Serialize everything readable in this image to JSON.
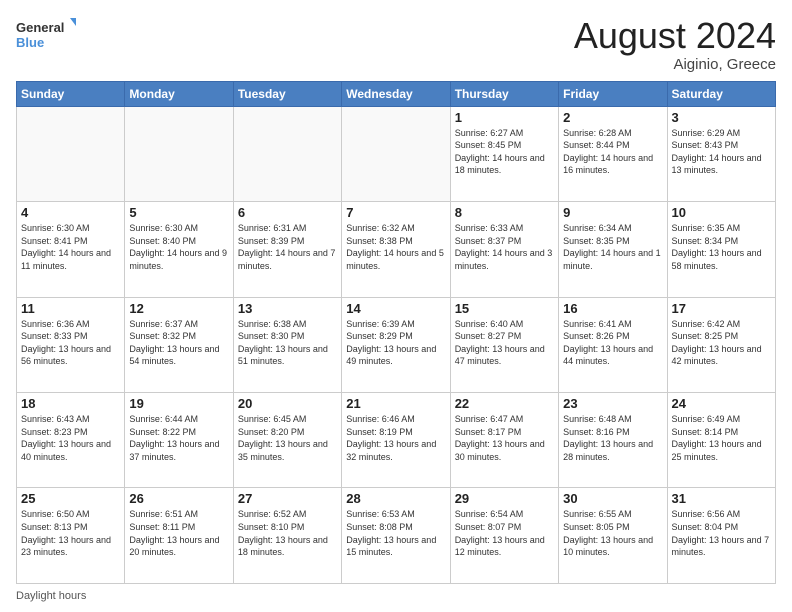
{
  "logo": {
    "line1": "General",
    "line2": "Blue"
  },
  "title": "August 2024",
  "location": "Aiginio, Greece",
  "days_header": [
    "Sunday",
    "Monday",
    "Tuesday",
    "Wednesday",
    "Thursday",
    "Friday",
    "Saturday"
  ],
  "footer_text": "Daylight hours",
  "weeks": [
    [
      {
        "day": "",
        "info": ""
      },
      {
        "day": "",
        "info": ""
      },
      {
        "day": "",
        "info": ""
      },
      {
        "day": "",
        "info": ""
      },
      {
        "day": "1",
        "info": "Sunrise: 6:27 AM\nSunset: 8:45 PM\nDaylight: 14 hours\nand 18 minutes."
      },
      {
        "day": "2",
        "info": "Sunrise: 6:28 AM\nSunset: 8:44 PM\nDaylight: 14 hours\nand 16 minutes."
      },
      {
        "day": "3",
        "info": "Sunrise: 6:29 AM\nSunset: 8:43 PM\nDaylight: 14 hours\nand 13 minutes."
      }
    ],
    [
      {
        "day": "4",
        "info": "Sunrise: 6:30 AM\nSunset: 8:41 PM\nDaylight: 14 hours\nand 11 minutes."
      },
      {
        "day": "5",
        "info": "Sunrise: 6:30 AM\nSunset: 8:40 PM\nDaylight: 14 hours\nand 9 minutes."
      },
      {
        "day": "6",
        "info": "Sunrise: 6:31 AM\nSunset: 8:39 PM\nDaylight: 14 hours\nand 7 minutes."
      },
      {
        "day": "7",
        "info": "Sunrise: 6:32 AM\nSunset: 8:38 PM\nDaylight: 14 hours\nand 5 minutes."
      },
      {
        "day": "8",
        "info": "Sunrise: 6:33 AM\nSunset: 8:37 PM\nDaylight: 14 hours\nand 3 minutes."
      },
      {
        "day": "9",
        "info": "Sunrise: 6:34 AM\nSunset: 8:35 PM\nDaylight: 14 hours\nand 1 minute."
      },
      {
        "day": "10",
        "info": "Sunrise: 6:35 AM\nSunset: 8:34 PM\nDaylight: 13 hours\nand 58 minutes."
      }
    ],
    [
      {
        "day": "11",
        "info": "Sunrise: 6:36 AM\nSunset: 8:33 PM\nDaylight: 13 hours\nand 56 minutes."
      },
      {
        "day": "12",
        "info": "Sunrise: 6:37 AM\nSunset: 8:32 PM\nDaylight: 13 hours\nand 54 minutes."
      },
      {
        "day": "13",
        "info": "Sunrise: 6:38 AM\nSunset: 8:30 PM\nDaylight: 13 hours\nand 51 minutes."
      },
      {
        "day": "14",
        "info": "Sunrise: 6:39 AM\nSunset: 8:29 PM\nDaylight: 13 hours\nand 49 minutes."
      },
      {
        "day": "15",
        "info": "Sunrise: 6:40 AM\nSunset: 8:27 PM\nDaylight: 13 hours\nand 47 minutes."
      },
      {
        "day": "16",
        "info": "Sunrise: 6:41 AM\nSunset: 8:26 PM\nDaylight: 13 hours\nand 44 minutes."
      },
      {
        "day": "17",
        "info": "Sunrise: 6:42 AM\nSunset: 8:25 PM\nDaylight: 13 hours\nand 42 minutes."
      }
    ],
    [
      {
        "day": "18",
        "info": "Sunrise: 6:43 AM\nSunset: 8:23 PM\nDaylight: 13 hours\nand 40 minutes."
      },
      {
        "day": "19",
        "info": "Sunrise: 6:44 AM\nSunset: 8:22 PM\nDaylight: 13 hours\nand 37 minutes."
      },
      {
        "day": "20",
        "info": "Sunrise: 6:45 AM\nSunset: 8:20 PM\nDaylight: 13 hours\nand 35 minutes."
      },
      {
        "day": "21",
        "info": "Sunrise: 6:46 AM\nSunset: 8:19 PM\nDaylight: 13 hours\nand 32 minutes."
      },
      {
        "day": "22",
        "info": "Sunrise: 6:47 AM\nSunset: 8:17 PM\nDaylight: 13 hours\nand 30 minutes."
      },
      {
        "day": "23",
        "info": "Sunrise: 6:48 AM\nSunset: 8:16 PM\nDaylight: 13 hours\nand 28 minutes."
      },
      {
        "day": "24",
        "info": "Sunrise: 6:49 AM\nSunset: 8:14 PM\nDaylight: 13 hours\nand 25 minutes."
      }
    ],
    [
      {
        "day": "25",
        "info": "Sunrise: 6:50 AM\nSunset: 8:13 PM\nDaylight: 13 hours\nand 23 minutes."
      },
      {
        "day": "26",
        "info": "Sunrise: 6:51 AM\nSunset: 8:11 PM\nDaylight: 13 hours\nand 20 minutes."
      },
      {
        "day": "27",
        "info": "Sunrise: 6:52 AM\nSunset: 8:10 PM\nDaylight: 13 hours\nand 18 minutes."
      },
      {
        "day": "28",
        "info": "Sunrise: 6:53 AM\nSunset: 8:08 PM\nDaylight: 13 hours\nand 15 minutes."
      },
      {
        "day": "29",
        "info": "Sunrise: 6:54 AM\nSunset: 8:07 PM\nDaylight: 13 hours\nand 12 minutes."
      },
      {
        "day": "30",
        "info": "Sunrise: 6:55 AM\nSunset: 8:05 PM\nDaylight: 13 hours\nand 10 minutes."
      },
      {
        "day": "31",
        "info": "Sunrise: 6:56 AM\nSunset: 8:04 PM\nDaylight: 13 hours\nand 7 minutes."
      }
    ]
  ]
}
